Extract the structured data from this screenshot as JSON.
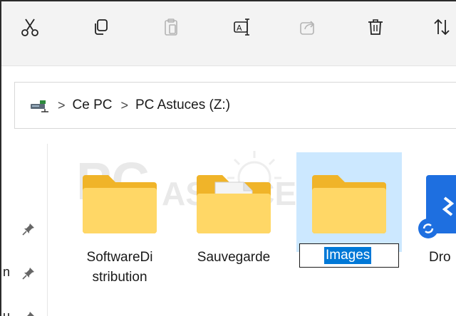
{
  "toolbar": {
    "items": [
      {
        "icon": "cut-icon",
        "enabled": true
      },
      {
        "icon": "copy-icon",
        "enabled": true
      },
      {
        "icon": "paste-icon",
        "enabled": false
      },
      {
        "icon": "rename-icon",
        "enabled": true
      },
      {
        "icon": "share-icon",
        "enabled": false
      },
      {
        "icon": "delete-icon",
        "enabled": true
      },
      {
        "icon": "sort-icon",
        "enabled": true
      }
    ]
  },
  "breadcrumb": {
    "items": [
      "Ce PC",
      "PC Astuces (Z:)"
    ],
    "separator": ">"
  },
  "nav": {
    "frag_1": "n",
    "frag_2": "u"
  },
  "files": [
    {
      "name_line1": "SoftwareDi",
      "name_line2": "stribution"
    },
    {
      "name_line1": "Sauvegarde"
    },
    {
      "name_line1": "Images",
      "renaming": true
    },
    {
      "name_line1": "Dro"
    }
  ],
  "colors": {
    "folder_back": "#f0b429",
    "folder_front": "#ffd766",
    "selection_bg": "#cce8ff",
    "text_selection": "#0078d7",
    "cloud_folder": "#1e6fe0"
  }
}
